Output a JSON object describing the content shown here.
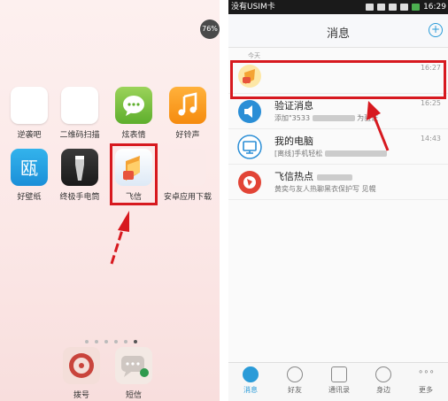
{
  "launcher": {
    "battery_badge": "76%",
    "apps_row1": [
      {
        "label": "逆袭吧",
        "icon": "app-icon"
      },
      {
        "label": "二维码扫描",
        "icon": "qrcode-icon"
      },
      {
        "label": "炫表情",
        "icon": "chat-bubble-icon"
      },
      {
        "label": "好铃声",
        "icon": "music-note-icon"
      }
    ],
    "apps_row2": [
      {
        "label": "好壁纸",
        "icon": "wallpaper-icon"
      },
      {
        "label": "终极手电筒",
        "icon": "flashlight-icon"
      },
      {
        "label": "飞信",
        "icon": "fetion-icon"
      },
      {
        "label": "安卓应用下载",
        "icon": "store-icon"
      }
    ],
    "page_dots": 6,
    "active_dot": 5,
    "dock": [
      {
        "label": "拨号",
        "icon": "dialer-icon"
      },
      {
        "label": "短信",
        "icon": "sms-icon"
      }
    ]
  },
  "fetion": {
    "status_left": "没有USIM卡",
    "status_time": "16:29",
    "title": "消息",
    "plus_label": "+",
    "today_label": "今天",
    "messages": [
      {
        "name": "",
        "preview": "",
        "time": "16:27",
        "icon": "fetion-avatar-icon"
      },
      {
        "name": "验证消息",
        "preview": "添加\"3533",
        "preview_tail": "为验证",
        "time": "16:25",
        "icon": "speaker-icon"
      },
      {
        "name": "我的电脑",
        "preview": "[离线]手机轻松",
        "preview_tail": "",
        "time": "14:43",
        "icon": "computer-icon"
      },
      {
        "name": "飞信热点",
        "preview": "黄奕与友人热聊黑衣保护写 见幌",
        "preview_tail": "",
        "time": "",
        "icon": "hotspot-icon"
      }
    ],
    "tabs": [
      {
        "label": "消息",
        "icon": "message-icon"
      },
      {
        "label": "好友",
        "icon": "friends-icon"
      },
      {
        "label": "通讯录",
        "icon": "contacts-icon"
      },
      {
        "label": "身边",
        "icon": "location-icon"
      },
      {
        "label": "更多",
        "icon": "more-icon"
      }
    ],
    "colors": {
      "accent": "#2a9bd8",
      "highlight_box": "#d7191f"
    }
  }
}
